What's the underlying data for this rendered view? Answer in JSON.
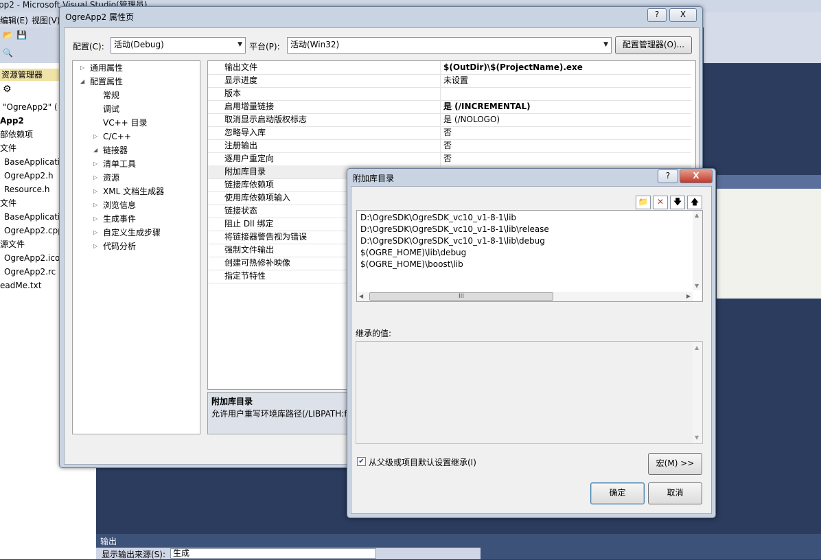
{
  "vs": {
    "title": "pp2 - Microsoft Visual Studio(管理员)",
    "menu": [
      "编辑(E)",
      "视图(V)"
    ],
    "solution_explorer": "资源管理器",
    "tree": [
      "\"OgreApp2\" (",
      "App2",
      "部依赖项",
      "文件",
      "BaseApplicatio",
      "OgreApp2.h",
      "Resource.h",
      "文件",
      "BaseApplicatio",
      "OgreApp2.cpp",
      "源文件",
      "OgreApp2.ico",
      "OgreApp2.rc",
      "eadMe.txt"
    ],
    "output_title": "输出",
    "output_source_label": "显示输出来源(S):",
    "output_source_value": "生成"
  },
  "prop_dialog": {
    "title": "OgreApp2 属性页",
    "help_btn": "?",
    "close_btn": "X",
    "config_label": "配置(C):",
    "config_value": "活动(Debug)",
    "platform_label": "平台(P):",
    "platform_value": "活动(Win32)",
    "config_manager": "配置管理器(O)...",
    "nav": [
      {
        "label": "通用属性",
        "arrow": "▷"
      },
      {
        "label": "配置属性",
        "arrow": "◢"
      },
      {
        "label": "常规",
        "arrow": ""
      },
      {
        "label": "调试",
        "arrow": ""
      },
      {
        "label": "VC++ 目录",
        "arrow": ""
      },
      {
        "label": "C/C++",
        "arrow": "▷"
      },
      {
        "label": "链接器",
        "arrow": "◢"
      },
      {
        "label": "清单工具",
        "arrow": "▷"
      },
      {
        "label": "资源",
        "arrow": "▷"
      },
      {
        "label": "XML 文档生成器",
        "arrow": "▷"
      },
      {
        "label": "浏览信息",
        "arrow": "▷"
      },
      {
        "label": "生成事件",
        "arrow": "▷"
      },
      {
        "label": "自定义生成步骤",
        "arrow": "▷"
      },
      {
        "label": "代码分析",
        "arrow": "▷"
      }
    ],
    "grid": [
      {
        "name": "输出文件",
        "value": "$(OutDir)\\$(ProjectName).exe",
        "bold": true
      },
      {
        "name": "显示进度",
        "value": "未设置",
        "bold": false
      },
      {
        "name": "版本",
        "value": "",
        "bold": false
      },
      {
        "name": "启用增量链接",
        "value": "是 (/INCREMENTAL)",
        "bold": true
      },
      {
        "name": "取消显示启动版权标志",
        "value": "是 (/NOLOGO)",
        "bold": false
      },
      {
        "name": "忽略导入库",
        "value": "否",
        "bold": false
      },
      {
        "name": "注册输出",
        "value": "否",
        "bold": false
      },
      {
        "name": "逐用户重定向",
        "value": "否",
        "bold": false
      },
      {
        "name": "附加库目录",
        "value": "",
        "bold": false
      },
      {
        "name": "链接库依赖项",
        "value": "",
        "bold": false
      },
      {
        "name": "使用库依赖项输入",
        "value": "",
        "bold": false
      },
      {
        "name": "链接状态",
        "value": "",
        "bold": false
      },
      {
        "name": "阻止 Dll 绑定",
        "value": "",
        "bold": false
      },
      {
        "name": "将链接器警告视为错误",
        "value": "",
        "bold": false
      },
      {
        "name": "强制文件输出",
        "value": "",
        "bold": false
      },
      {
        "name": "创建可热修补映像",
        "value": "",
        "bold": false
      },
      {
        "name": "指定节特性",
        "value": "",
        "bold": false
      }
    ],
    "desc_title": "附加库目录",
    "desc_text": "允许用户重写环境库路径(/LIBPATH:f"
  },
  "lib_dialog": {
    "title": "附加库目录",
    "help_btn": "?",
    "close_btn": "X",
    "paths": [
      "D:\\OgreSDK\\OgreSDK_vc10_v1-8-1\\lib",
      "D:\\OgreSDK\\OgreSDK_vc10_v1-8-1\\lib\\release",
      "D:\\OgreSDK\\OgreSDK_vc10_v1-8-1\\lib\\debug",
      "$(OGRE_HOME)\\lib\\debug",
      "$(OGRE_HOME)\\boost\\lib"
    ],
    "hscroll_grip": "III",
    "inherited_label": "继承的值:",
    "inherit_checkbox": "从父级或项目默认设置继承(I)",
    "inherit_checked": true,
    "macro_btn": "宏(M) >>",
    "ok_btn": "确定",
    "cancel_btn": "取消"
  }
}
